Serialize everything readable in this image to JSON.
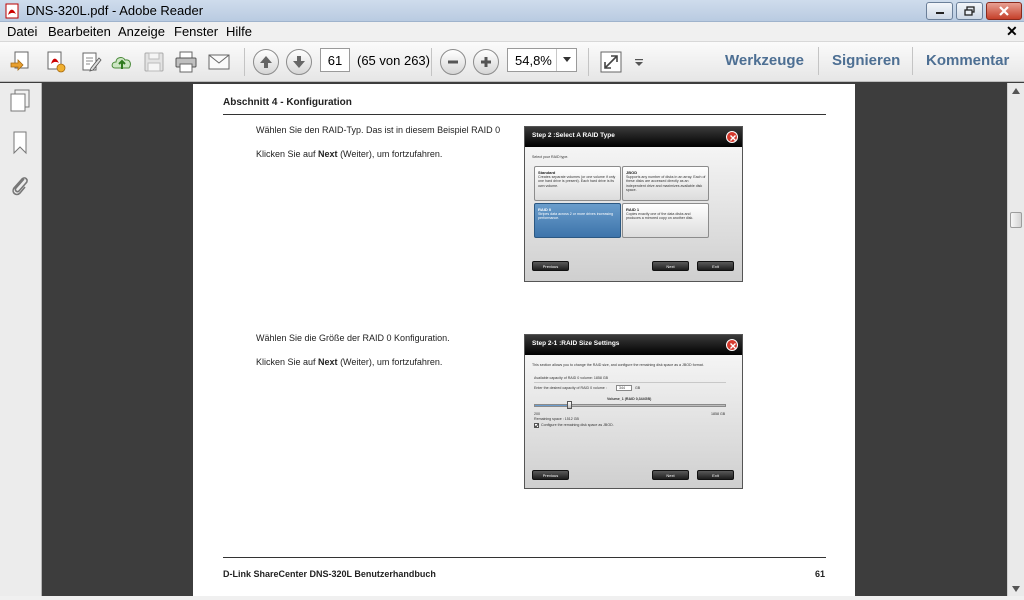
{
  "window": {
    "title": "DNS-320L.pdf - Adobe Reader",
    "doc_close": "✕"
  },
  "menu": [
    "Datei",
    "Bearbeiten",
    "Anzeige",
    "Fenster",
    "Hilfe"
  ],
  "toolbar": {
    "page_number": "61",
    "page_count": "(65 von 263)",
    "zoom": "54,8%",
    "panels": [
      "Werkzeuge",
      "Signieren",
      "Kommentar"
    ]
  },
  "colors": {
    "panel_link": "#4d6f93",
    "selected_tile": "#3d74ab",
    "dialog_header": "#000000"
  },
  "page": {
    "header": "Abschnitt 4 - Konfiguration",
    "block1": {
      "line1": "Wählen Sie den RAID-Typ. Das ist in diesem Beispiel RAID 0",
      "line2_pre": "Klicken Sie auf ",
      "line2_bold": "Next",
      "line2_post": " (Weiter), um fortzufahren."
    },
    "block2": {
      "line1": "Wählen Sie die Größe der RAID 0 Konfiguration.",
      "line2_pre": "Klicken Sie auf ",
      "line2_bold": "Next",
      "line2_post": " (Weiter), um fortzufahren."
    },
    "footer_left": "D-Link ShareCenter DNS-320L Benutzerhandbuch",
    "footer_right": "61"
  },
  "dialog1": {
    "title": "Step 2 :Select A RAID Type",
    "prompt": "Select your RAID type.",
    "tiles": [
      {
        "name": "Standard",
        "desc": "Creates separate volumes (or one volume if only one hard drive is present). Each hard drive is its own volume."
      },
      {
        "name": "JBOD",
        "desc": "Supports any number of disks in an array. Each of these disks are accessed directly as an independent drive and maximizes available disk space."
      },
      {
        "name": "RAID 0",
        "desc": "Stripes data across 2 or more drives increasing performance."
      },
      {
        "name": "RAID 1",
        "desc": "Copies exactly one of the data disks and produces a mirrored copy on another disk."
      }
    ],
    "buttons": {
      "previous": "Previous",
      "next": "Next",
      "exit": "Exit"
    }
  },
  "dialog2": {
    "title": "Step 2-1 :RAID Size Settings",
    "intro": "This section allows you to change the RAID size, and configure the remaining disk space as a JBOD format.",
    "available": "Available capacity of RAID 0 volume: 1858 GB",
    "enter_label": "Enter the desired capacity of RAID 0 volume :",
    "enter_value": "344",
    "unit": "GB",
    "volume_label": "Volume_1 (RAID 0,344GB)",
    "slider_min": "200",
    "slider_max": "1858 GB",
    "slider_fraction": 0.18,
    "remaining": "Remaining space : 1512 GB",
    "checkbox_label": "Configure the remaining disk space as JBOD.",
    "buttons": {
      "previous": "Previous",
      "next": "Next",
      "exit": "Exit"
    }
  }
}
